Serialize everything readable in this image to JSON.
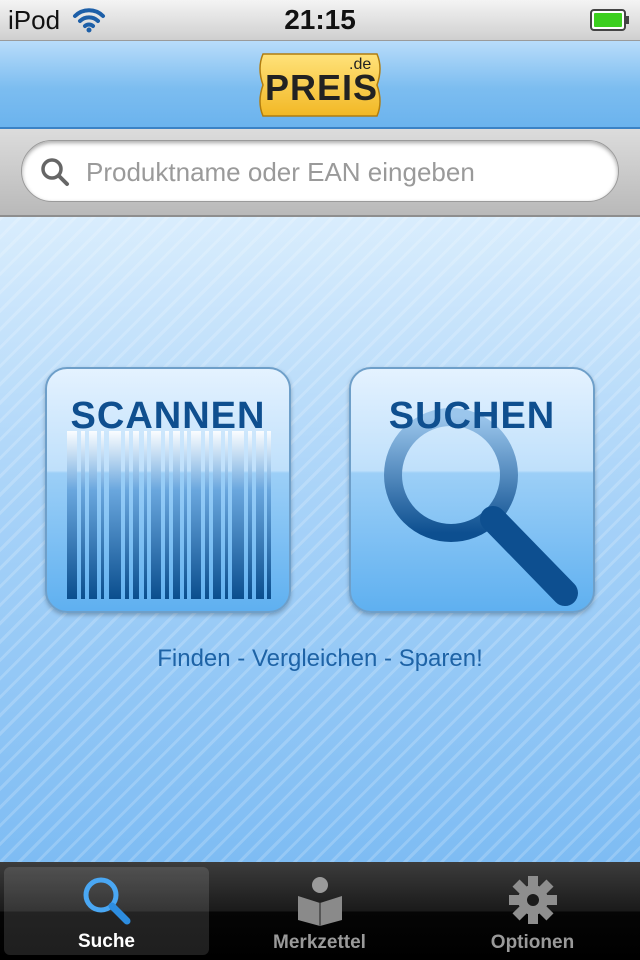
{
  "status_bar": {
    "device": "iPod",
    "time": "21:15",
    "wifi_icon": "wifi-icon",
    "battery_icon": "battery-icon"
  },
  "header": {
    "logo_text": "PREIS",
    "logo_suffix": ".de"
  },
  "search": {
    "placeholder": "Produktname oder EAN eingeben",
    "value": ""
  },
  "main": {
    "scan_label": "SCANNEN",
    "search_label": "SUCHEN",
    "slogan": "Finden - Vergleichen - Sparen!"
  },
  "tabbar": {
    "tabs": [
      {
        "label": "Suche",
        "icon": "magnifier-icon",
        "active": true
      },
      {
        "label": "Merkzettel",
        "icon": "notepad-icon",
        "active": false
      },
      {
        "label": "Optionen",
        "icon": "gear-icon",
        "active": false
      }
    ]
  },
  "colors": {
    "accent": "#1e63a6",
    "header_blue": "#7cbdf0",
    "logo_yellow": "#f5c842"
  }
}
